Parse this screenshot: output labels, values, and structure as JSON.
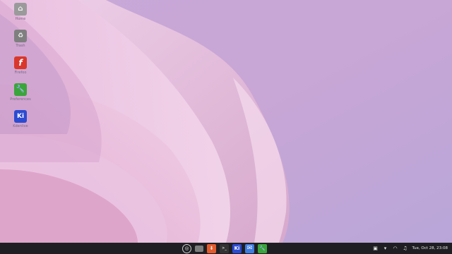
{
  "desktop": {
    "icons": [
      {
        "label": "Home",
        "icon": "home-folder-icon"
      },
      {
        "label": "Trash",
        "icon": "trash-icon"
      },
      {
        "label": "Firefoo",
        "icon": "flash-app-icon"
      },
      {
        "label": "Preferences",
        "icon": "preferences-icon"
      },
      {
        "label": "Kdenlive",
        "icon": "ki-app-icon"
      }
    ]
  },
  "taskbar": {
    "apps": [
      {
        "name": "app-menu",
        "glyph": "◎"
      },
      {
        "name": "file-manager",
        "glyph": ""
      },
      {
        "name": "software-center",
        "glyph": "⬇"
      },
      {
        "name": "terminal",
        "glyph": ">_"
      },
      {
        "name": "ki-app",
        "glyph": "Ki"
      },
      {
        "name": "mail",
        "glyph": "✉"
      },
      {
        "name": "preferences",
        "glyph": "🔧"
      }
    ],
    "tray": {
      "clock": "Tue, Oct 28, 23:08"
    }
  },
  "colors": {
    "taskbar_bg": "#1f1f23",
    "wallpaper_base": "#c9a6d6",
    "ki_blue": "#2c4bd1",
    "flash_red": "#d9372b",
    "pref_green": "#3aa53a"
  }
}
